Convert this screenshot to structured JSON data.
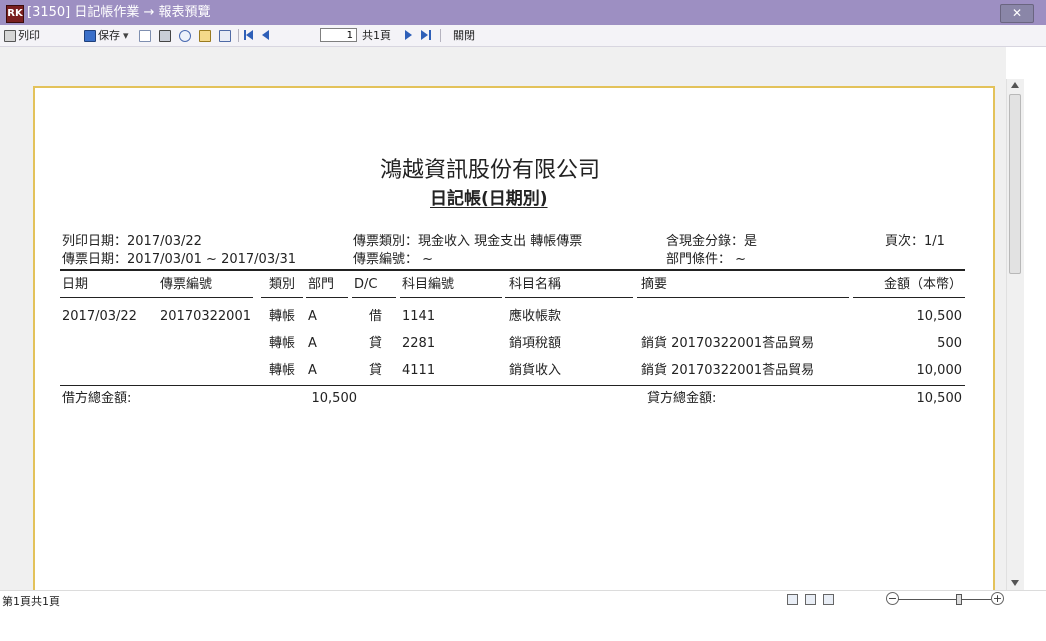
{
  "window": {
    "title": "[3150] 日記帳作業 → 報表預覽",
    "app_icon_text": "RK",
    "close_label": "✕"
  },
  "toolbar": {
    "print_label": "列印",
    "save_label": "保存",
    "save_dropdown": "▾",
    "page_current": "1",
    "page_total": "共1頁",
    "close_label": "關閉"
  },
  "report": {
    "company": "鴻越資訊股份有限公司",
    "title": "日記帳(日期別)",
    "meta": {
      "print_date": "列印日期：2017/03/22",
      "voucher_type": "傳票類別：現金收入 現金支出 轉帳傳票",
      "include_cash": "含現金分錄：是",
      "page_no": "頁次：1/1",
      "voucher_date": "傳票日期：2017/03/01 ~ 2017/03/31",
      "voucher_no": "傳票編號： ~",
      "dept_cond": "部門條件： ~"
    },
    "columns": [
      "日期",
      "傳票編號",
      "類別",
      "部門",
      "D/C",
      "科目編號",
      "科目名稱",
      "摘要",
      "金額（本幣）"
    ],
    "rows": [
      {
        "date": "2017/03/22",
        "voucher": "20170322001",
        "type": "轉帳",
        "dept": "A",
        "dc": "借",
        "acct_no": "1141",
        "acct_name": "應收帳款",
        "memo": "",
        "amount": "10,500"
      },
      {
        "date": "",
        "voucher": "",
        "type": "轉帳",
        "dept": "A",
        "dc": "貸",
        "acct_no": "2281",
        "acct_name": "銷項稅額",
        "memo": "銷貨 20170322001荅品貿易",
        "amount": "500"
      },
      {
        "date": "",
        "voucher": "",
        "type": "轉帳",
        "dept": "A",
        "dc": "貸",
        "acct_no": "4111",
        "acct_name": "銷貨收入",
        "memo": "銷貨 20170322001荅品貿易",
        "amount": "10,000"
      }
    ],
    "totals": {
      "debit_label": "借方總金額:",
      "debit_amount": "10,500",
      "credit_label": "貸方總金額:",
      "credit_amount": "10,500"
    }
  },
  "status": {
    "page_info": "第1頁共1頁",
    "zoom_out": "−",
    "zoom_in": "+"
  },
  "colors": {
    "titlebar": "#9d8fc2",
    "page_border": "#e3c25a"
  }
}
